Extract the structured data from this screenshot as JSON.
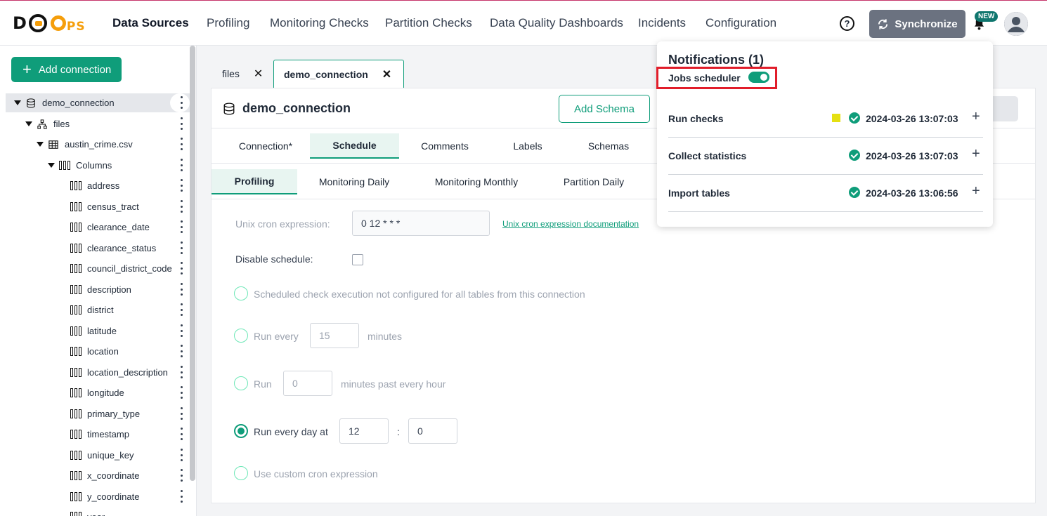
{
  "nav": {
    "items": [
      "Data Sources",
      "Profiling",
      "Monitoring Checks",
      "Partition Checks",
      "Data Quality Dashboards",
      "Incidents",
      "Configuration"
    ],
    "help_icon_glyph": "?",
    "sync_label": "Synchronize",
    "new_badge": "NEW"
  },
  "sidebar": {
    "add_connection_label": "Add connection",
    "tree": {
      "connection": "demo_connection",
      "schema": "files",
      "table": "austin_crime.csv",
      "columns_folder": "Columns",
      "columns": [
        "address",
        "census_tract",
        "clearance_date",
        "clearance_status",
        "council_district_code",
        "description",
        "district",
        "latitude",
        "location",
        "location_description",
        "longitude",
        "primary_type",
        "timestamp",
        "unique_key",
        "x_coordinate",
        "y_coordinate",
        "year"
      ]
    }
  },
  "tabs": [
    {
      "label": "files"
    },
    {
      "label": "demo_connection"
    }
  ],
  "panel": {
    "title": "demo_connection",
    "add_schema_label": "Add Schema",
    "main_tabs": [
      "Connection*",
      "Schedule",
      "Comments",
      "Labels",
      "Schemas"
    ],
    "sub_tabs": [
      "Profiling",
      "Monitoring Daily",
      "Monitoring Monthly",
      "Partition Daily"
    ],
    "form": {
      "cron_label": "Unix cron expression:",
      "cron_value": "0 12 * * *",
      "cron_doc_link": "Unix cron expression documentation",
      "disable_label": "Disable schedule:",
      "option_not_configured": "Scheduled check execution not configured for all tables from this connection",
      "option_run_every_prefix": "Run every",
      "option_run_every_value": "15",
      "option_run_every_suffix": "minutes",
      "option_run_prefix": "Run",
      "option_run_value": "0",
      "option_run_suffix": "minutes past every hour",
      "option_daily_label": "Run every day at",
      "option_daily_hour": "12",
      "option_daily_sep": ":",
      "option_daily_minute": "0",
      "option_custom": "Use custom cron expression"
    }
  },
  "notifications": {
    "title": "Notifications (1)",
    "scheduler_label": "Jobs scheduler",
    "jobs": [
      {
        "name": "Run checks",
        "time": "2024-03-26 13:07:03"
      },
      {
        "name": "Collect statistics",
        "time": "2024-03-26 13:07:03"
      },
      {
        "name": "Import tables",
        "time": "2024-03-26 13:06:56"
      }
    ],
    "expand_glyph": "+"
  },
  "colors": {
    "accent": "#0f9d7a",
    "highlight_border": "#e11d2a",
    "running_indicator": "#e5e012"
  }
}
